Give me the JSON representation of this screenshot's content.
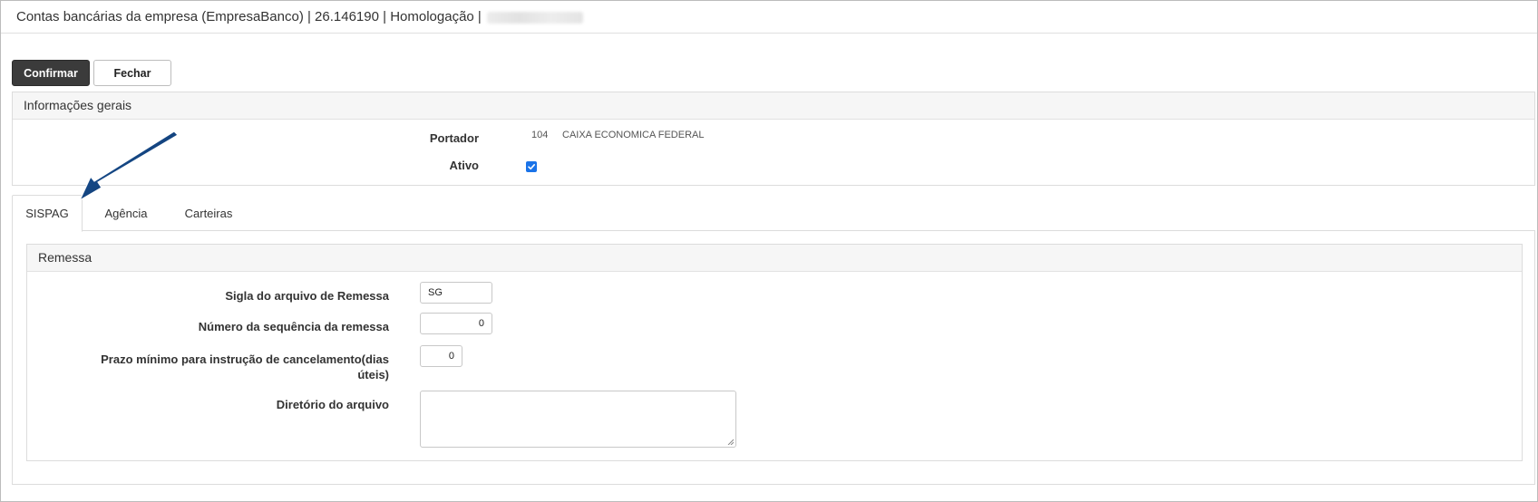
{
  "window": {
    "title": "Contas bancárias da empresa (EmpresaBanco) | 26.146190 | Homologação |"
  },
  "toolbar": {
    "confirm_label": "Confirmar",
    "close_label": "Fechar"
  },
  "general": {
    "header": "Informações gerais",
    "portador_label": "Portador",
    "portador_code": "104",
    "portador_name": "CAIXA ECONOMICA FEDERAL",
    "ativo_label": "Ativo",
    "ativo_checked": true
  },
  "tabs": [
    {
      "label": "SISPAG",
      "active": true
    },
    {
      "label": "Agência",
      "active": false
    },
    {
      "label": "Carteiras",
      "active": false
    }
  ],
  "remessa": {
    "header": "Remessa",
    "sigla_label": "Sigla do arquivo de Remessa",
    "sigla_value": "SG",
    "sequencia_label": "Número da sequência da remessa",
    "sequencia_value": "0",
    "prazo_label_line1": "Prazo mínimo para instrução de cancelamento(dias",
    "prazo_label_line2": "úteis)",
    "prazo_value": "0",
    "diretorio_label": "Diretório do arquivo",
    "diretorio_value": ""
  },
  "colors": {
    "primary_button": "#3b3b3b",
    "checkbox": "#1a73e8",
    "annotation_arrow": "#0d3f7a"
  }
}
